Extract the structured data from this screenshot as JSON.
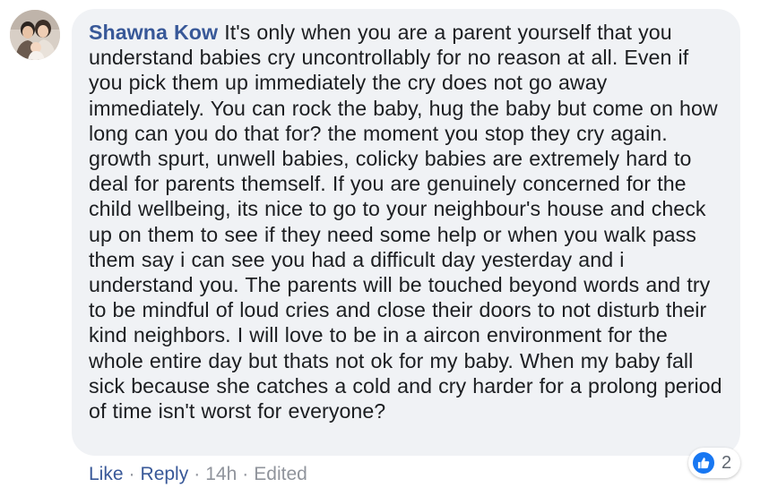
{
  "comment": {
    "author": "Shawna Kow",
    "text": "It's only when you are a parent yourself that you understand babies cry uncontrollably for no reason at all. Even if you pick them up immediately the cry does not go away immediately. You can rock the baby, hug the baby but come on how long can you do that for? the moment you stop they cry again. growth spurt, unwell babies, colicky babies are extremely hard to deal for parents themself. If you are genuinely concerned for the child wellbeing, its nice to go to your neighbour's house and check up on them to see if they need some help or when you walk pass them say i can see you had a difficult day yesterday and i understand you. The parents will be touched beyond words and try to be mindful of loud cries and close their doors to not disturb their kind neighbors. I will love to be in a aircon environment for the whole entire day but thats not ok for my baby. When my baby fall sick because she catches a cold and cry harder for a prolong period of time isn't worst for everyone?",
    "avatar_icon": "user-avatar-photo"
  },
  "reactions": {
    "icon": "thumbs-up-icon",
    "count": "2",
    "color": "#1877f2"
  },
  "actions": {
    "like_label": "Like",
    "reply_label": "Reply",
    "time": "14h",
    "edited_label": "Edited",
    "separator": "·"
  },
  "colors": {
    "bubble_bg": "#f0f2f5",
    "author": "#385898",
    "text": "#1c1e21",
    "meta": "#90949c"
  }
}
